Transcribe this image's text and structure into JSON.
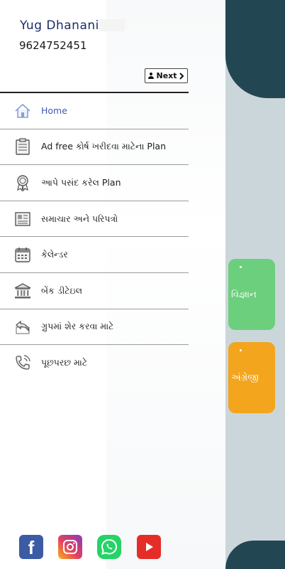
{
  "user": {
    "name": "Yug Dhanani",
    "phone": "9624752451"
  },
  "next_button": {
    "label": "Next"
  },
  "menu": [
    {
      "label": "Home",
      "icon": "home-icon",
      "active": true
    },
    {
      "label": "Ad free કોર્ષ ખરીદવા માટેના Plan",
      "icon": "clipboard-list-icon"
    },
    {
      "label": "આપે પસંદ કરેલ Plan",
      "icon": "award-badge-icon"
    },
    {
      "label": "સમાચાર અને પરિપત્રો",
      "icon": "newspaper-icon"
    },
    {
      "label": "કેલેન્ડર",
      "icon": "calendar-icon"
    },
    {
      "label": "બેંક ડીટેઇલ",
      "icon": "bank-icon"
    },
    {
      "label": "ગ્રુપમાં શેર કરવા માટે",
      "icon": "share-icon"
    },
    {
      "label": "પૂછપરછ માટે",
      "icon": "phone-ringing-icon"
    }
  ],
  "background": {
    "cards": [
      "વિજ્ઞાન",
      "અંગ્રેજી"
    ]
  },
  "social": [
    {
      "name": "facebook-icon",
      "glyph": "f"
    },
    {
      "name": "instagram-icon",
      "glyph": ""
    },
    {
      "name": "whatsapp-icon",
      "glyph": ""
    },
    {
      "name": "youtube-icon",
      "glyph": ""
    }
  ],
  "colors": {
    "accent": "#3c59b8",
    "name_text": "#1b2a6b",
    "header_bg": "#234653",
    "card_green": "#6ccf7d",
    "card_orange": "#f3a51d"
  }
}
